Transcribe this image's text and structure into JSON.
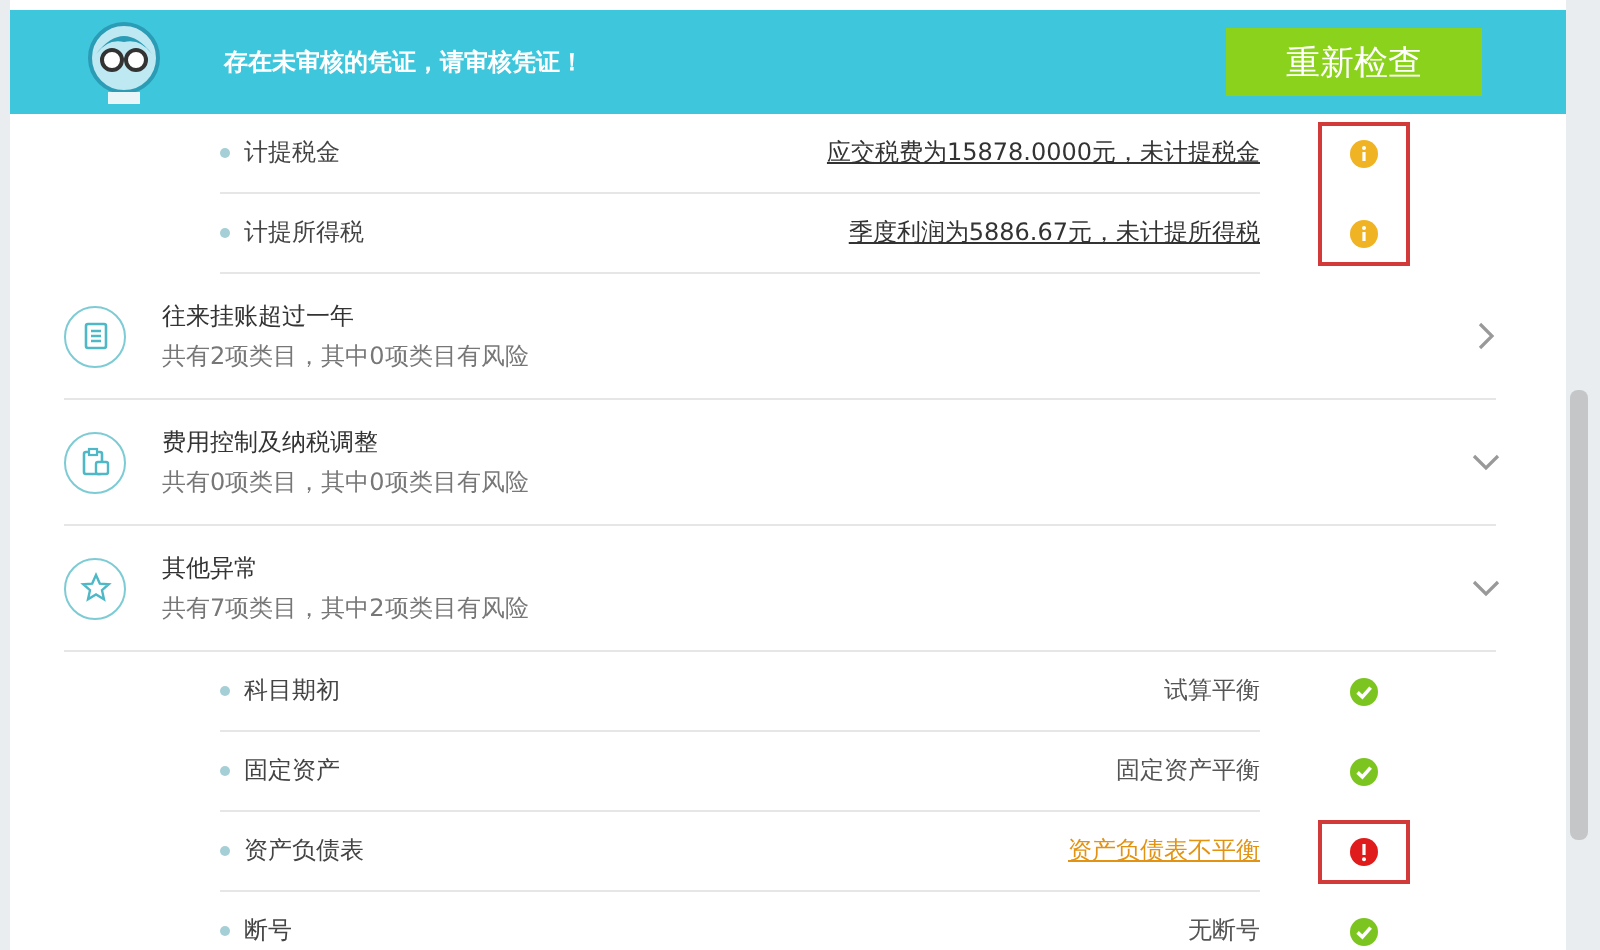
{
  "banner": {
    "message": "存在未审核的凭证，请审核凭证！",
    "button": "重新检查"
  },
  "top_rows": [
    {
      "label": "计提税金",
      "value": "应交税费为15878.0000元，未计提税金",
      "kind": "link",
      "status": {
        "kind": "info"
      },
      "highlighted": true
    },
    {
      "label": "计提所得税",
      "value": "季度利润为5886.67元，未计提所得税",
      "kind": "link",
      "status": {
        "kind": "info"
      },
      "highlighted": true
    }
  ],
  "categories": [
    {
      "title": "往来挂账超过一年",
      "summary": "共有2项类目，其中0项类目有风险",
      "expanded": false
    },
    {
      "title": "费用控制及纳税调整",
      "summary": "共有0项类目，其中0项类目有风险",
      "expanded": true
    },
    {
      "title": "其他异常",
      "summary": "共有7项类目，其中2项类目有风险",
      "expanded": true,
      "children": [
        {
          "label": "科目期初",
          "value": "试算平衡",
          "kind": "text",
          "status": {
            "kind": "ok"
          },
          "highlighted": false
        },
        {
          "label": "固定资产",
          "value": "固定资产平衡",
          "kind": "text",
          "status": {
            "kind": "ok"
          },
          "highlighted": false
        },
        {
          "label": "资产负债表",
          "value": "资产负债表不平衡",
          "kind": "alert-link",
          "status": {
            "kind": "error"
          },
          "highlighted": true
        },
        {
          "label": "断号",
          "value": "无断号",
          "kind": "text",
          "status": {
            "kind": "ok"
          },
          "highlighted": false
        }
      ]
    }
  ]
}
